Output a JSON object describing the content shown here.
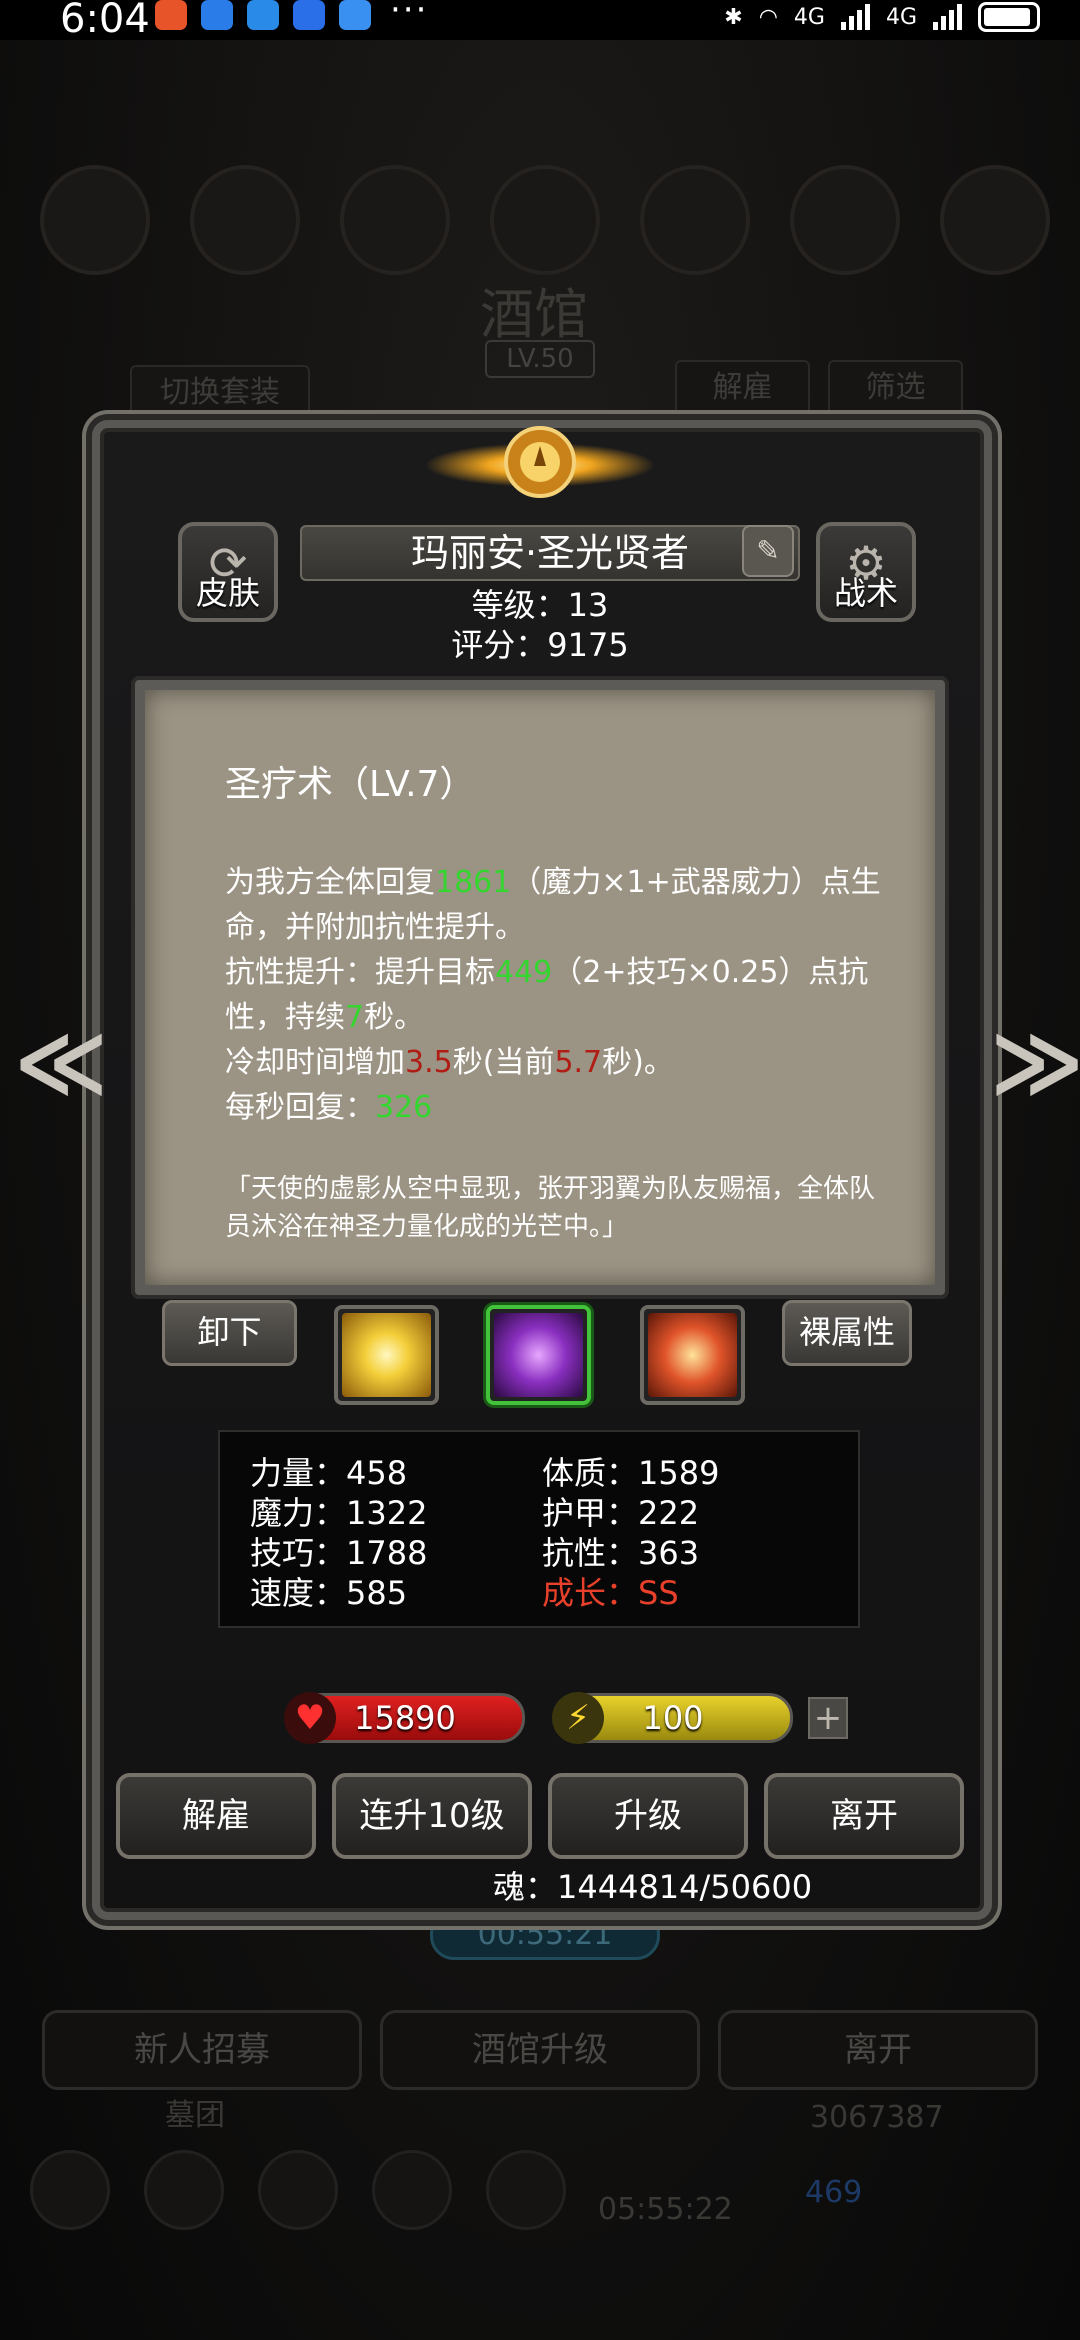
{
  "status_bar": {
    "time": "6:04",
    "more": "···",
    "signal_1": "4G",
    "signal_2": "4G"
  },
  "background": {
    "title": "酒馆",
    "level": "LV.50",
    "switch_set": "切换套装",
    "dismiss": "解雇",
    "filter": "筛选",
    "timer": "00:55:21",
    "recruit": "新人招募",
    "upgrade_tavern": "酒馆升级",
    "leave": "离开",
    "group": "墓团",
    "gold": "3067387",
    "gems": "469",
    "bottom_timer": "05:55:22"
  },
  "hero": {
    "skin_label": "皮肤",
    "tactics_label": "战术",
    "name": "玛丽安·圣光贤者",
    "level_line": "等级：13",
    "score_line": "评分：9175"
  },
  "skill": {
    "title": "圣疗术（LV.7）",
    "desc_1a": "为我方全体回复",
    "desc_1b": "1861",
    "desc_1c": "（魔力×1+武器威力）点生命，并附加抗性提升。",
    "desc_2a": "抗性提升：提升目标",
    "desc_2b": "449",
    "desc_2c": "（2+技巧×0.25）点抗性，持续",
    "desc_2d": "7",
    "desc_2e": "秒。",
    "desc_3a": "冷却时间增加",
    "desc_3b": "3.5",
    "desc_3c": "秒(当前",
    "desc_3d": "5.7",
    "desc_3e": "秒)。",
    "desc_4a": "每秒回复：",
    "desc_4b": "326",
    "quote": "「天使的虚影从空中显现，张开羽翼为队友赐福，全体队员沐浴在神圣力量化成的光芒中。」"
  },
  "skill_row": {
    "unequip": "卸下",
    "naked_attr": "裸属性"
  },
  "stats": {
    "strength": "力量：458",
    "magic": "魔力：1322",
    "skill": "技巧：1788",
    "speed": "速度：585",
    "constitution": "体质：1589",
    "armor": "护甲：222",
    "resistance": "抗性：363",
    "growth": "成长：SS"
  },
  "bars": {
    "hp": "15890",
    "energy": "100",
    "plus": "+"
  },
  "actions": {
    "dismiss": "解雇",
    "level_up_10": "连升10级",
    "level_up": "升级",
    "leave": "离开"
  },
  "soul": "魂：1444814/50600",
  "colors": {
    "green_value": "#34d52f",
    "red_value": "#b01d14",
    "growth": "#e8402a",
    "parchment": "#9b9383"
  }
}
